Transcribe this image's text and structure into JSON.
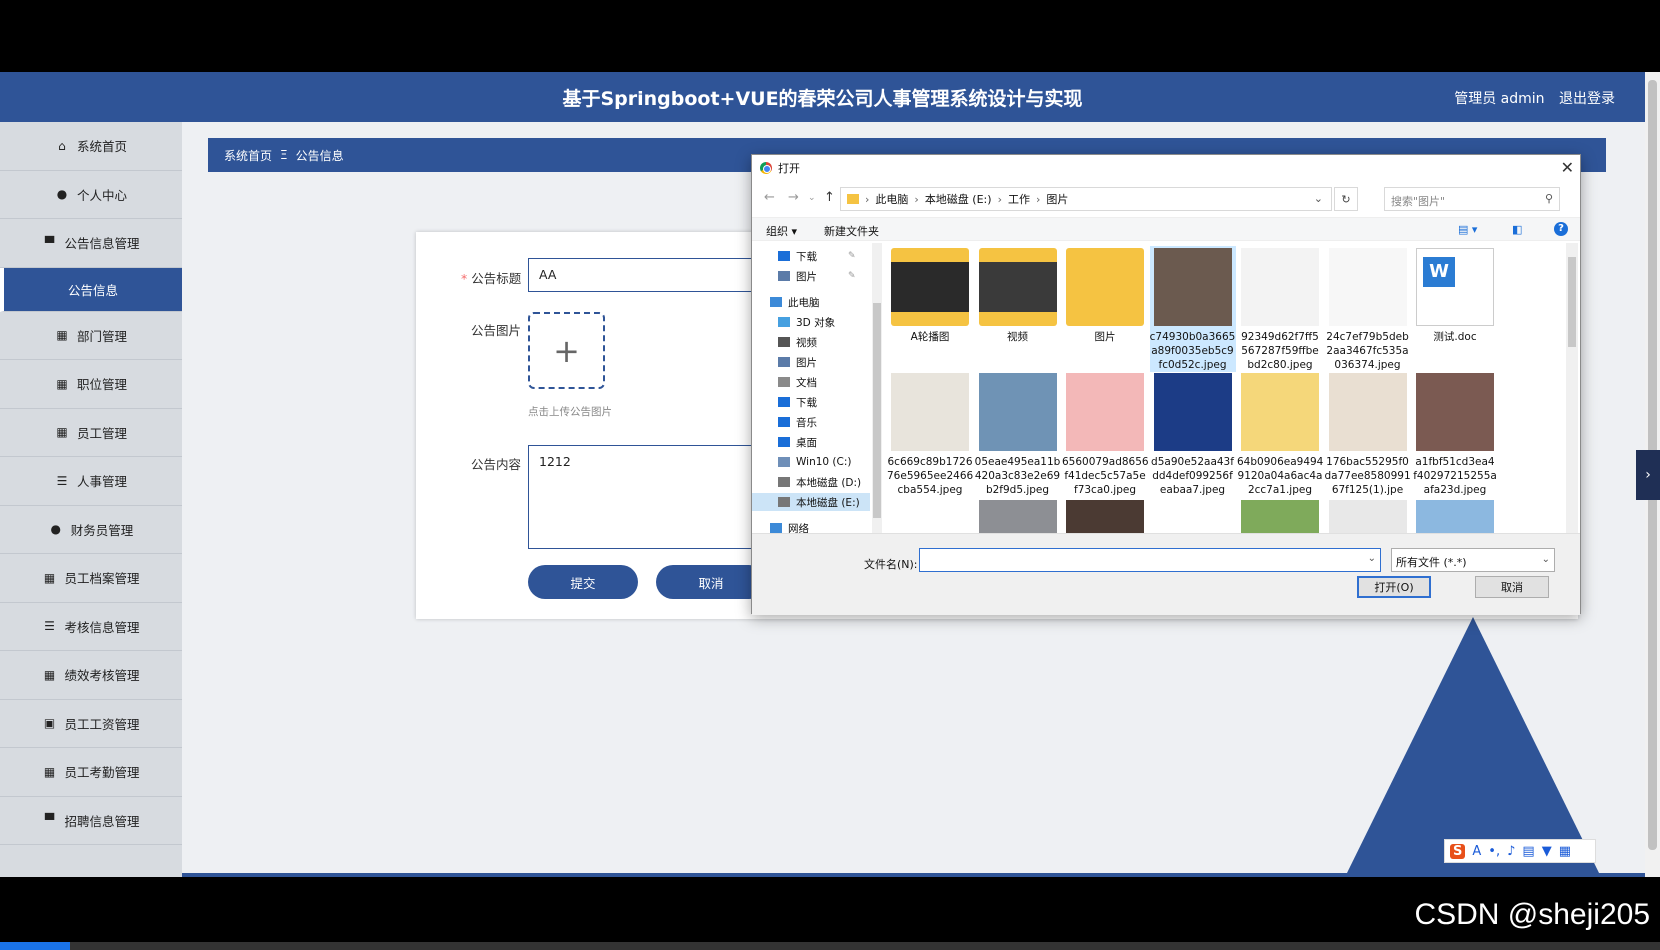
{
  "header": {
    "title": "基于Springboot+VUE的春荣公司人事管理系统设计与实现",
    "user": "管理员 admin",
    "logout": "退出登录"
  },
  "sidebar": {
    "items": [
      {
        "label": "系统首页",
        "icon": "home-icon",
        "glyph": "⌂"
      },
      {
        "label": "个人中心",
        "icon": "user-icon",
        "glyph": "●"
      },
      {
        "label": "公告信息管理",
        "icon": "monitor-icon",
        "glyph": "▀"
      },
      {
        "label": "公告信息",
        "icon": "",
        "glyph": ""
      },
      {
        "label": "部门管理",
        "icon": "grid-icon",
        "glyph": "▦"
      },
      {
        "label": "职位管理",
        "icon": "grid-icon",
        "glyph": "▦"
      },
      {
        "label": "员工管理",
        "icon": "grid-icon",
        "glyph": "▦"
      },
      {
        "label": "人事管理",
        "icon": "list-icon",
        "glyph": "☰"
      },
      {
        "label": "财务员管理",
        "icon": "user-icon",
        "glyph": "●"
      },
      {
        "label": "员工档案管理",
        "icon": "grid-icon",
        "glyph": "▦"
      },
      {
        "label": "考核信息管理",
        "icon": "list-icon",
        "glyph": "☰"
      },
      {
        "label": "绩效考核管理",
        "icon": "grid-icon",
        "glyph": "▦"
      },
      {
        "label": "员工工资管理",
        "icon": "clipboard-icon",
        "glyph": "▣"
      },
      {
        "label": "员工考勤管理",
        "icon": "grid-icon",
        "glyph": "▦"
      },
      {
        "label": "招聘信息管理",
        "icon": "monitor-icon",
        "glyph": "▀"
      }
    ]
  },
  "breadcrumb": {
    "home": "系统首页",
    "sep": "Ξ",
    "current": "公告信息"
  },
  "form": {
    "title_label": "公告标题",
    "title_value": "AA",
    "image_label": "公告图片",
    "upload_hint": "点击上传公告图片",
    "content_label": "公告内容",
    "content_value": "1212",
    "submit": "提交",
    "cancel": "取消"
  },
  "dialog": {
    "title": "打开",
    "path": [
      "此电脑",
      "本地磁盘 (E:)",
      "工作",
      "图片"
    ],
    "search_placeholder": "搜索\"图片\"",
    "organize": "组织 ▾",
    "new_folder": "新建文件夹",
    "tree": [
      {
        "label": "下载",
        "color": "#1a6ed8"
      },
      {
        "label": "图片",
        "color": "#5b7ba8"
      },
      {
        "label": "此电脑",
        "color": "#3c8ad8"
      },
      {
        "label": "3D 对象",
        "color": "#46a0e0"
      },
      {
        "label": "视频",
        "color": "#555555"
      },
      {
        "label": "图片",
        "color": "#5b7ba8"
      },
      {
        "label": "文档",
        "color": "#8a8a8a"
      },
      {
        "label": "下载",
        "color": "#1a6ed8"
      },
      {
        "label": "音乐",
        "color": "#1a6ed8"
      },
      {
        "label": "桌面",
        "color": "#1a6ed8"
      },
      {
        "label": "Win10 (C:)",
        "color": "#6f8fb8"
      },
      {
        "label": "本地磁盘 (D:)",
        "color": "#777777"
      },
      {
        "label": "本地磁盘 (E:)",
        "color": "#777777"
      },
      {
        "label": "网络",
        "color": "#3c8ad8"
      }
    ],
    "files": [
      {
        "name": "A轮播图",
        "kind": "folder",
        "color": "#2a2a2a"
      },
      {
        "name": "视频",
        "kind": "folder",
        "color": "#3a3a3a"
      },
      {
        "name": "图片",
        "kind": "folder",
        "color": "#f5c342"
      },
      {
        "name": "c74930b0a3665a89f0035eb5c9fc0d52c.jpeg",
        "kind": "photo",
        "color": "#6b5a4f"
      },
      {
        "name": "92349d62f7ff5567287f59ffbebd2c80.jpeg",
        "kind": "photo",
        "color": "#f3f3f3"
      },
      {
        "name": "24c7ef79b5deb2aa3467fc535a036374.jpeg",
        "kind": "photo",
        "color": "#f7f7f7"
      },
      {
        "name": "测试.doc",
        "kind": "doc",
        "color": "#2b7cd3"
      },
      {
        "name": "6c669c89b172676e5965ee2466cba554.jpeg",
        "kind": "photo",
        "color": "#e8e4dc"
      },
      {
        "name": "05eae495ea11b420a3c83e2e69b2f9d5.jpeg",
        "kind": "photo",
        "color": "#6f93b5"
      },
      {
        "name": "6560079ad8656f41dec5c57a5ef73ca0.jpeg",
        "kind": "photo",
        "color": "#f3b8b8"
      },
      {
        "name": "d5a90e52aa43fdd4def099256feabaa7.jpeg",
        "kind": "photo",
        "color": "#1c3c86"
      },
      {
        "name": "64b0906ea94949120a04a6ac4a2cc7a1.jpeg",
        "kind": "photo",
        "color": "#f5d77a"
      },
      {
        "name": "176bac55295f0da77ee858099167f125(1).jpeg",
        "kind": "photo",
        "color": "#e9dfd2"
      },
      {
        "name": "a1fbf51cd3ea4f40297215255aafa23d.jpeg",
        "kind": "photo",
        "color": "#7b5a52"
      }
    ],
    "filename_label": "文件名(N):",
    "filename_value": "",
    "filetype": "所有文件 (*.*)",
    "open": "打开(O)",
    "cancel": "取消"
  },
  "watermark": "CSDN @sheji205"
}
